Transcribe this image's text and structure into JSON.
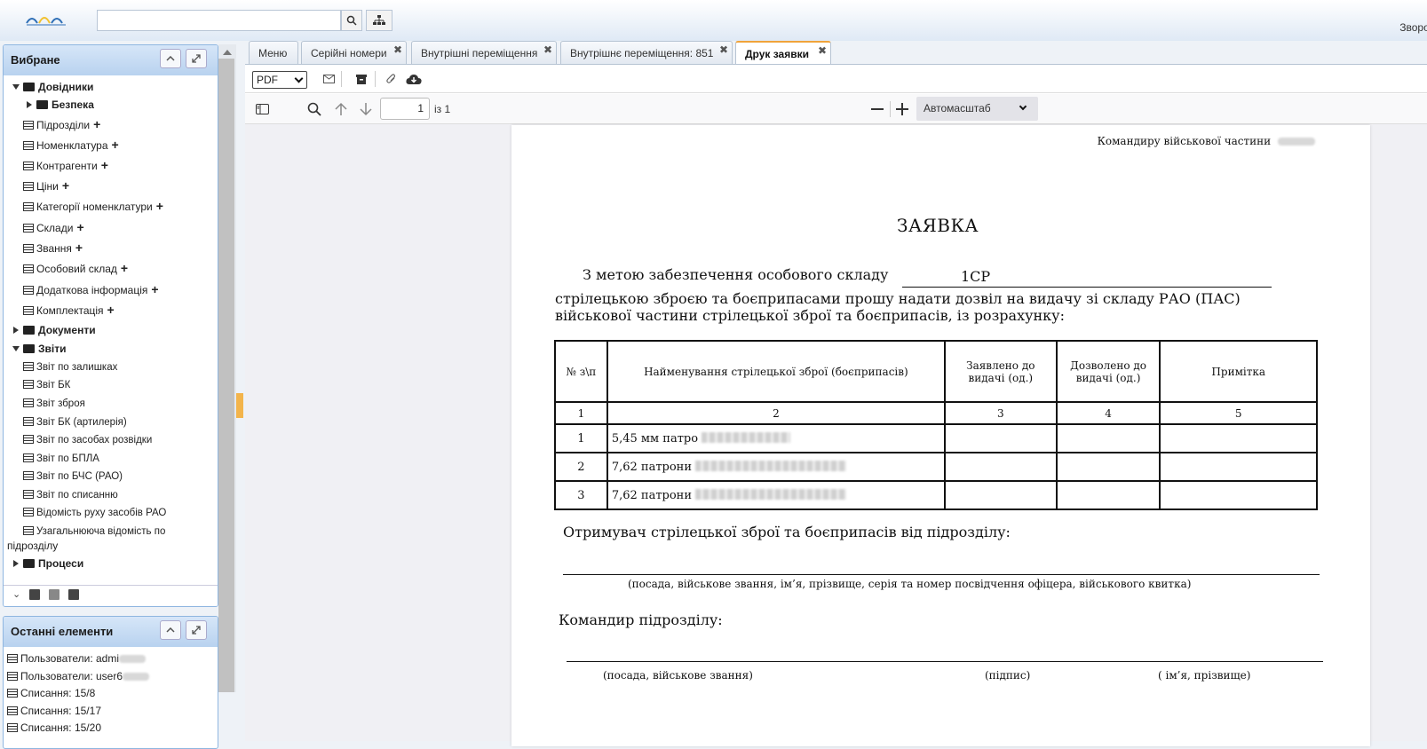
{
  "search": {
    "placeholder": ""
  },
  "header": {
    "feedback": "Зворот"
  },
  "favorites": {
    "title": "Вибране",
    "items": [
      {
        "label": "Довідники",
        "type": "folder-open"
      },
      {
        "label": "Безпека",
        "type": "folder-closed"
      },
      {
        "label": "Підрозділи",
        "type": "doc-plus"
      },
      {
        "label": "Номенклатура",
        "type": "doc-plus"
      },
      {
        "label": "Контрагенти",
        "type": "doc-plus"
      },
      {
        "label": "Ціни",
        "type": "doc-plus"
      },
      {
        "label": "Категорії номенклатури",
        "type": "doc-plus"
      },
      {
        "label": "Склади",
        "type": "doc-plus"
      },
      {
        "label": "Звання",
        "type": "doc-plus"
      },
      {
        "label": "Особовий склад",
        "type": "doc-plus"
      },
      {
        "label": "Додаткова інформація",
        "type": "doc-plus"
      },
      {
        "label": "Комплектація",
        "type": "doc-plus"
      },
      {
        "label": "Документи",
        "type": "folder-closed"
      },
      {
        "label": "Звіти",
        "type": "folder-open"
      },
      {
        "label": "Звіт по залишках",
        "type": "report"
      },
      {
        "label": "Звіт БК",
        "type": "report"
      },
      {
        "label": "Звіт зброя",
        "type": "report"
      },
      {
        "label": "Звіт БК (артилерія)",
        "type": "report"
      },
      {
        "label": "Звіт по засобах розвідки",
        "type": "report"
      },
      {
        "label": "Звіт по БПЛА",
        "type": "report"
      },
      {
        "label": "Звіт по БЧС (РАО)",
        "type": "report"
      },
      {
        "label": "Звіт по списанню",
        "type": "report"
      },
      {
        "label": "Відомість руху засобів РАО",
        "type": "report"
      },
      {
        "label": "Узагальнююча відомість по",
        "type": "report"
      },
      {
        "label": "підрозділу",
        "type": "wrap"
      },
      {
        "label": "Процеси",
        "type": "folder-closed"
      }
    ]
  },
  "recent": {
    "title": "Останні елементи",
    "items": [
      "Пользователи: admi",
      "Пользователи: user6",
      "Списання: 15/8",
      "Списання: 15/17",
      "Списання: 15/20"
    ]
  },
  "tabs": [
    {
      "label": "Меню",
      "closable": false
    },
    {
      "label": "Серійні номери",
      "closable": true
    },
    {
      "label": "Внутрішні переміщення",
      "closable": true
    },
    {
      "label": "Внутрішнє переміщення: 851",
      "closable": true
    },
    {
      "label": "Друк заявки",
      "closable": true,
      "active": true
    }
  ],
  "toolbar": {
    "format": "PDF"
  },
  "viewer": {
    "page": "1",
    "page_of": "із 1",
    "zoom": "Автомасштаб"
  },
  "doc": {
    "addressee": "Командиру військової частини",
    "title": "ЗАЯВКА",
    "purpose": "З метою забезпечення особового складу",
    "purpose_value": "1СР",
    "body": "стрілецькою зброєю та боєприпасами прошу надати дозвіл на видачу зі складу РАО (ПАС) військової частини стрілецької зброї та боєприпасів, із розрахунку:",
    "table": {
      "headers": [
        "№ з\\п",
        "Найменування стрілецької зброї (боєприпасів)",
        "Заявлено до видачі (од.)",
        "Дозволено до видачі (од.)",
        "Примітка"
      ],
      "numbers": [
        "1",
        "2",
        "3",
        "4",
        "5"
      ],
      "rows": [
        {
          "n": "1",
          "name": "5,45 мм патро"
        },
        {
          "n": "2",
          "name": "7,62 патрони"
        },
        {
          "n": "3",
          "name": "7,62 патрони"
        }
      ]
    },
    "receiver": "Отримувач стрілецької зброї та боєприпасів від підрозділу:",
    "receiver_caption": "(посада, військове звання, ім’я, прізвище, серія та номер посвідчення офіцера, військового квитка)",
    "commander": "Командир підрозділу:",
    "cap_position": "(посада, військове звання)",
    "cap_sign": "(підпис)",
    "cap_name": "( ім’я, прізвище)"
  },
  "colors": {
    "accent": "#f0a33a",
    "panel_header": "#b8d2ef"
  }
}
